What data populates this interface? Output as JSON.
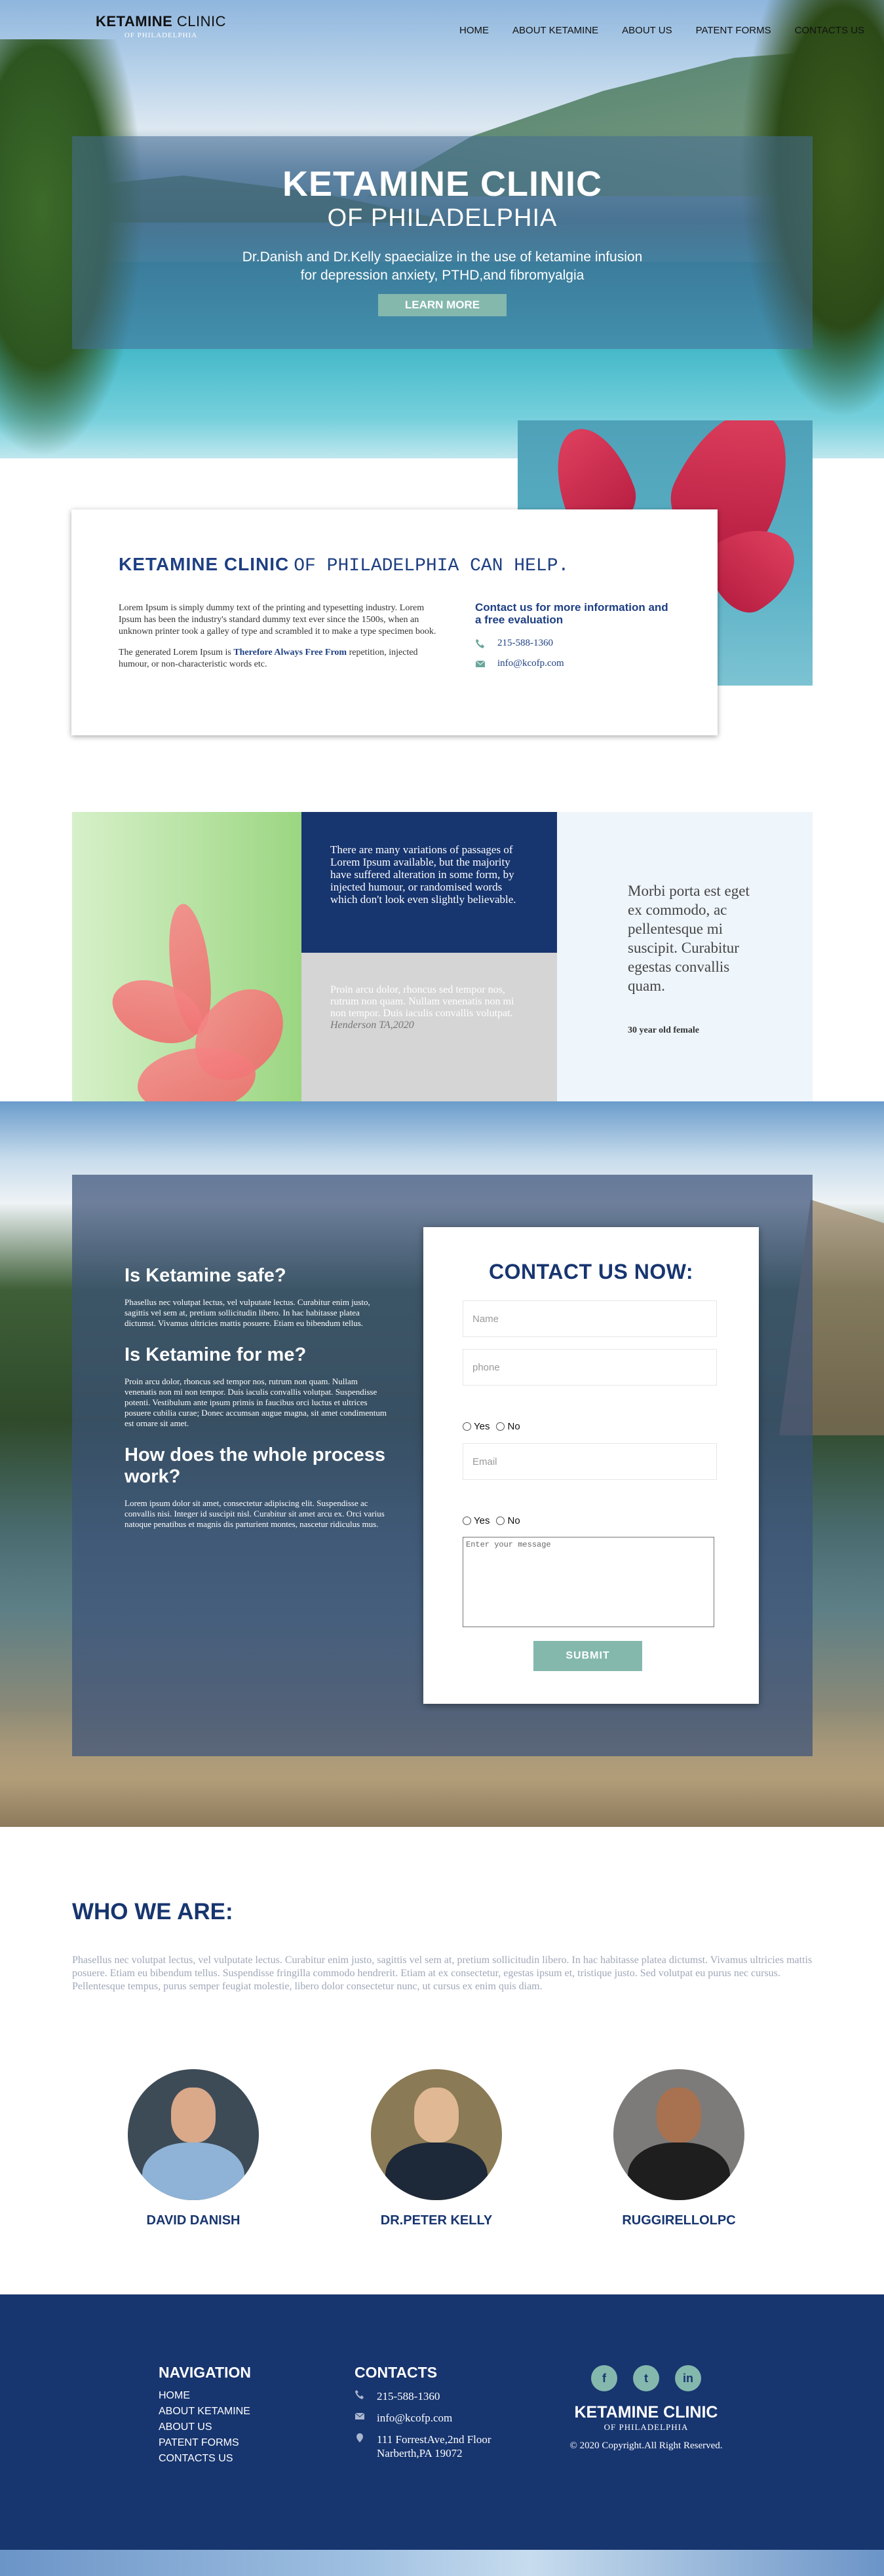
{
  "header": {
    "logo_main": "KETAMINE",
    "logo_rest": "CLINIC",
    "logo_sub": "OF PHILADELPHIA",
    "menu": [
      "HOME",
      "ABOUT KETAMINE",
      "ABOUT US",
      "PATENT FORMS",
      "CONTACTS US"
    ]
  },
  "hero": {
    "title": "KETAMINE CLINIC",
    "subtitle": "OF PHILADELPHIA",
    "line1": "Dr.Danish and Dr.Kelly spaecialize in the use of ketamine infusion",
    "line2": "for depression anxiety, PTHD,and fibromyalgia",
    "button": "LEARN MORE"
  },
  "help": {
    "title_bold": "KETAMINE CLINIC",
    "title_rest": "OF PHILADELPHIA CAN HELP.",
    "para1": "Lorem Ipsum is simply dummy text of the printing and typesetting industry. Lorem Ipsum has been the industry's standard dummy text ever since the 1500s, when an unknown printer took a galley of type and scrambled it to make a type specimen book.",
    "para2_a": "The generated Lorem Ipsum is ",
    "para2_b": "Therefore Always Free From",
    "para2_c": " repetition, injected humour, or non-characteristic words etc.",
    "contact_title": "Contact us for more information and a free evaluation",
    "phone": "215-588-1360",
    "email": "info@kcofp.com",
    "phone_icon": "phone-icon",
    "email_icon": "envelope-icon"
  },
  "features": {
    "blue_text": "There are many variations of passages of Lorem Ipsum available, but the majority have suffered alteration in some form, by injected humour, or randomised words which don't look even slightly believable.",
    "gray_text": "Proin arcu dolor, rhoncus sed tempor nos, rutrum non quam. Nullam venenatis non mi non tempor. Duis iaculis convallis volutpat.",
    "gray_author": "Henderson TA,2020",
    "quote": "Morbi porta est eget ex commodo, ac pellentesque mi suscipit. Curabitur egestas convallis quam.",
    "quote_author": "30 year old female"
  },
  "faq": [
    {
      "q": "Is Ketamine safe?",
      "a": "Phasellus nec volutpat lectus, vel vulputate lectus. Curabitur enim justo, sagittis vel sem at, pretium sollicitudin libero. In hac habitasse platea dictumst. Vivamus ultricies mattis posuere. Etiam eu bibendum tellus."
    },
    {
      "q": "Is Ketamine for me?",
      "a": "Proin arcu dolor, rhoncus sed tempor nos, rutrum non quam. Nullam venenatis non mi non tempor. Duis iaculis convallis volutpat. Suspendisse potenti. Vestibulum ante ipsum primis in faucibus orci luctus et ultrices posuere cubilia curae; Donec accumsan augue magna, sit amet condimentum est ornare sit amet."
    },
    {
      "q": "How does the whole process work?",
      "a": "Lorem ipsum dolor sit amet, consectetur adipiscing elit. Suspendisse ac convallis nisi. Integer id suscipit nisl. Curabitur sit amet arcu ex. Orci varius natoque penatibus et magnis dis parturient montes, nascetur ridiculus mus."
    }
  ],
  "form": {
    "title": "CONTACT US NOW:",
    "name_placeholder": "Name",
    "phone_placeholder": "phone",
    "email_placeholder": "Email",
    "message_placeholder": "Enter your message",
    "yes": "Yes",
    "no": "No",
    "submit": "SUBMIT"
  },
  "who": {
    "title": "WHO WE ARE:",
    "text": "Phasellus nec volutpat lectus, vel vulputate lectus. Curabitur enim justo, sagittis vel sem at, pretium sollicitudin libero. In hac habitasse platea dictumst. Vivamus ultricies mattis posuere. Etiam eu bibendum tellus. Suspendisse fringilla commodo hendrerit. Etiam at ex consectetur, egestas ipsum et, tristique justo. Sed volutpat eu purus nec cursus. Pellentesque tempus, purus semper feugiat molestie, libero dolor consectetur nunc, ut cursus ex enim quis diam.",
    "team": [
      "DAVID DANISH",
      "DR.PETER KELLY",
      "RUGGIRELLOLPC"
    ]
  },
  "footer": {
    "nav_title": "NAVIGATION",
    "nav": [
      "HOME",
      "ABOUT KETAMINE",
      "ABOUT US",
      "PATENT FORMS",
      "CONTACTS US"
    ],
    "contacts_title": "CONTACTS",
    "phone": "215-588-1360",
    "email": "info@kcofp.com",
    "address": "111 ForrestAve,2nd Floor Narberth,PA 19072",
    "social": [
      "f",
      "t",
      "in"
    ],
    "brand": "KETAMINE CLINIC",
    "brand_sub": "OF PHILADELPHIA",
    "copyright": "© 2020 Copyright.All Right Reserved."
  },
  "colors": {
    "navy": "#17356f",
    "accent": "#84b8ad",
    "title_blue": "#1e3f83"
  }
}
